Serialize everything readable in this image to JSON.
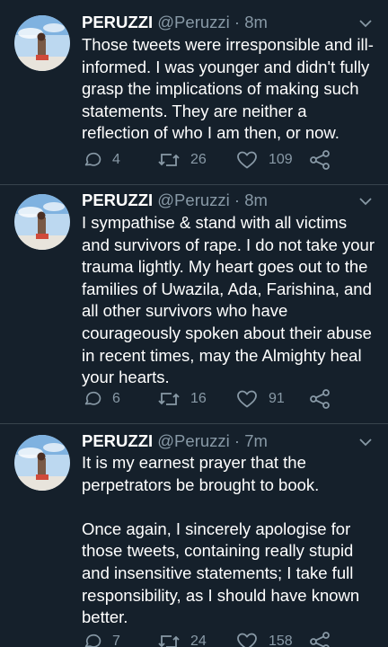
{
  "tweets": [
    {
      "name": "PERUZZI",
      "handle": "@Peruzzi",
      "separator": "·",
      "time": "8m",
      "text": "Those tweets were irresponsible and ill-informed. I was younger and didn't fully grasp the implications of making such statements. They are neither a reflection of who I am then, or now.",
      "replies": "4",
      "retweets": "26",
      "likes": "109"
    },
    {
      "name": "PERUZZI",
      "handle": "@Peruzzi",
      "separator": "·",
      "time": "8m",
      "text": "I sympathise & stand with all victims and survivors of rape. I do not take your trauma lightly. My heart goes out to the families of Uwazila, Ada, Farishina, and all other survivors who have courageously spoken about their abuse in recent times, may the Almighty heal your hearts.",
      "replies": "6",
      "retweets": "16",
      "likes": "91"
    },
    {
      "name": "PERUZZI",
      "handle": "@Peruzzi",
      "separator": "·",
      "time": "7m",
      "text": "It is my earnest prayer that the perpetrators be brought to book.\n\nOnce again, I sincerely apologise for those tweets, containing really stupid and insensitive statements; I take full responsibility, as I should have known better.",
      "replies": "7",
      "retweets": "24",
      "likes": "158"
    }
  ],
  "colors": {
    "background": "#15202b",
    "text": "#ffffff",
    "secondary": "#8899a6",
    "divider": "#38444d"
  },
  "icons": [
    "reply-icon",
    "retweet-icon",
    "like-icon",
    "share-icon",
    "chevron-down-icon"
  ]
}
